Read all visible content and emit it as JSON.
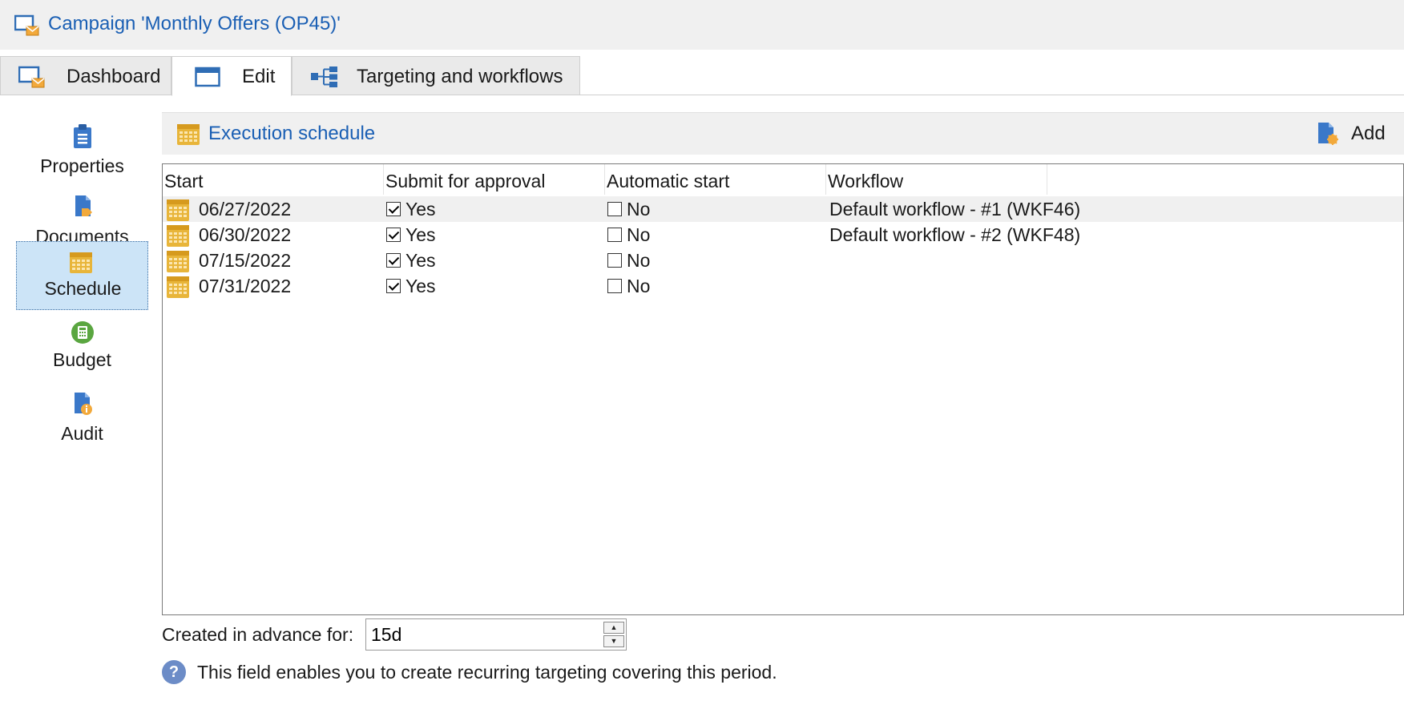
{
  "window": {
    "title": "Campaign 'Monthly Offers (OP45)'",
    "title_icon": "campaign-monitor-icon"
  },
  "tabs": [
    {
      "label": "Dashboard",
      "icon": "dashboard-icon",
      "active": false
    },
    {
      "label": "Edit",
      "icon": "edit-window-icon",
      "active": true
    },
    {
      "label": "Targeting and workflows",
      "icon": "workflow-icon",
      "active": false
    }
  ],
  "sidebar": {
    "items": [
      {
        "label": "Properties",
        "icon": "clipboard-icon",
        "selected": false
      },
      {
        "label": "Documents",
        "icon": "documents-icon",
        "selected": false
      },
      {
        "label": "Schedule",
        "icon": "calendar-icon",
        "selected": true
      },
      {
        "label": "Budget",
        "icon": "calculator-icon",
        "selected": false
      },
      {
        "label": "Audit",
        "icon": "audit-icon",
        "selected": false
      }
    ]
  },
  "section": {
    "title": "Execution schedule",
    "add_label": "Add"
  },
  "grid": {
    "columns": [
      "Start",
      "Submit for approval",
      "Automatic start",
      "Workflow"
    ],
    "rows": [
      {
        "start": "06/27/2022",
        "approval": "Yes",
        "approval_checked": true,
        "auto": "No",
        "auto_checked": false,
        "workflow": "Default workflow - #1 (WKF46)"
      },
      {
        "start": "06/30/2022",
        "approval": "Yes",
        "approval_checked": true,
        "auto": "No",
        "auto_checked": false,
        "workflow": "Default workflow - #2 (WKF48)"
      },
      {
        "start": "07/15/2022",
        "approval": "Yes",
        "approval_checked": true,
        "auto": "No",
        "auto_checked": false,
        "workflow": ""
      },
      {
        "start": "07/31/2022",
        "approval": "Yes",
        "approval_checked": true,
        "auto": "No",
        "auto_checked": false,
        "workflow": ""
      }
    ]
  },
  "advance": {
    "label": "Created in advance for:",
    "value": "15d"
  },
  "help": {
    "text": "This field enables you to create recurring targeting covering this period."
  },
  "colors": {
    "link_blue": "#1a5fb4",
    "calendar_yellow": "#e8b53a",
    "selected_bg": "#cce4f7"
  }
}
